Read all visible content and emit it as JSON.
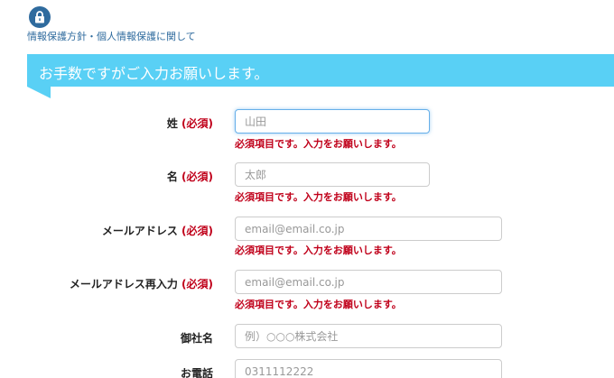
{
  "privacy": {
    "icon": "lock-icon",
    "link_text": "情報保護方針・個人情報保護に関して"
  },
  "banner": {
    "title": "お手数ですがご入力お願いします。",
    "color": "#59d0f5"
  },
  "required_mark": "(必須)",
  "error_message": "必須項目です。入力をお願いします。",
  "form": {
    "last_name": {
      "label": "姓",
      "required": true,
      "placeholder": "山田"
    },
    "first_name": {
      "label": "名",
      "required": true,
      "placeholder": "太郎"
    },
    "email": {
      "label": "メールアドレス",
      "required": true,
      "placeholder": "email@email.co.jp"
    },
    "email_confirm": {
      "label": "メールアドレス再入力",
      "required": true,
      "placeholder": "email@email.co.jp"
    },
    "company": {
      "label": "御社名",
      "required": false,
      "placeholder": "例）○○○株式会社"
    },
    "phone": {
      "label": "お電話",
      "required": false,
      "placeholder": "0311112222"
    }
  },
  "colors": {
    "accent": "#59d0f5",
    "link": "#2f6b9e",
    "error": "#c0001a"
  }
}
